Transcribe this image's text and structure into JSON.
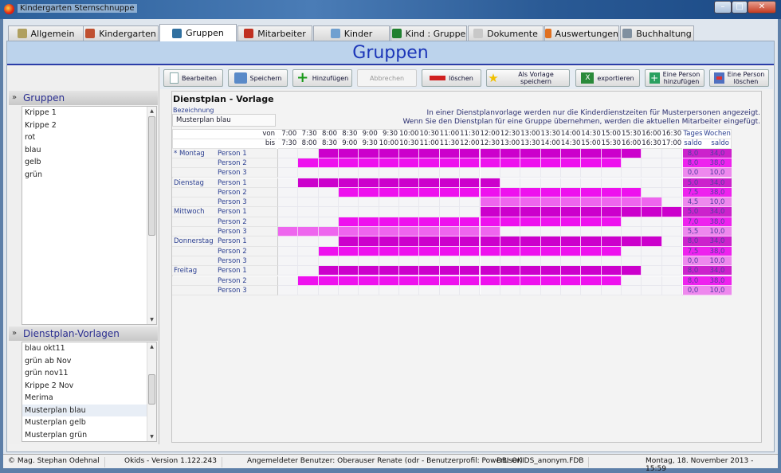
{
  "window": {
    "title": "Kindergarten Sternschnuppe",
    "controls": [
      "minimize",
      "maximize",
      "close"
    ]
  },
  "tabs": [
    {
      "label": "Allgemein",
      "icon": "tools-icon",
      "active": false
    },
    {
      "label": "Kindergarten",
      "icon": "house-icon",
      "active": false
    },
    {
      "label": "Gruppen",
      "icon": "group-icon",
      "active": true
    },
    {
      "label": "Mitarbeiter",
      "icon": "person-icon",
      "active": false
    },
    {
      "label": "Kinder",
      "icon": "children-icon",
      "active": false
    },
    {
      "label": "Kind : Gruppe",
      "icon": "tree-icon",
      "active": false
    },
    {
      "label": "Dokumente",
      "icon": "document-icon",
      "active": false
    },
    {
      "label": "Auswertungen",
      "icon": "chart-icon",
      "active": false
    },
    {
      "label": "Buchhaltung",
      "icon": "coins-icon",
      "active": false
    }
  ],
  "header": {
    "title": "Gruppen"
  },
  "toolbar": {
    "bearbeiten": "Bearbeiten",
    "speichern": "Speichern",
    "hinzufuegen": "Hinzufügen",
    "abbrechen": "Abbrechen",
    "loeschen": "löschen",
    "als_vorlage": "Als Vorlage speichern",
    "exportieren": "exportieren",
    "person_hinzu_1": "Eine Person",
    "person_hinzu_2": "hinzufügen",
    "person_loeschen_1": "Eine Person",
    "person_loeschen_2": "löschen"
  },
  "sidebar": {
    "gruppen_title": "Gruppen",
    "gruppen": [
      "Krippe 1",
      "Krippe 2",
      "rot",
      "blau",
      "gelb",
      "grün"
    ],
    "vorlagen_title": "Dienstplan-Vorlagen",
    "vorlagen": [
      "blau okt11",
      "grün ab Nov",
      "grün nov11",
      "Krippe 2 Nov",
      "Merima",
      "Musterplan blau",
      "Musterplan gelb",
      "Musterplan grün"
    ],
    "vorlagen_selected": "Musterplan blau"
  },
  "main": {
    "title": "Dienstplan - Vorlage",
    "bezeichnung_label": "Bezeichnung",
    "bezeichnung_value": "Musterplan blau",
    "info_line1": "In einer Dienstplanvorlage werden nur die Kinderdienstzeiten für Musterpersonen angezeigt.",
    "info_line2": "Wenn Sie den Dienstplan für eine Gruppe übernehmen, werden die aktuellen Mitarbeiter eingefügt."
  },
  "grid": {
    "von_label": "von",
    "bis_label": "bis",
    "von": [
      "7:00",
      "7:30",
      "8:00",
      "8:30",
      "9:00",
      "9:30",
      "10:00",
      "10:30",
      "11:00",
      "11:30",
      "12:00",
      "12:30",
      "13:00",
      "13:30",
      "14:00",
      "14:30",
      "15:00",
      "15:30",
      "16:00",
      "16:30"
    ],
    "bis": [
      "7:30",
      "8:00",
      "8:30",
      "9:00",
      "9:30",
      "10:00",
      "10:30",
      "11:00",
      "11:30",
      "12:00",
      "12:30",
      "13:00",
      "13:30",
      "14:00",
      "14:30",
      "15:00",
      "15:30",
      "16:00",
      "16:30",
      "17:00"
    ],
    "tages_1": "Tages",
    "tages_2": "saldo",
    "wochen_1": "Wochen",
    "wochen_2": "saldo",
    "person_colors": {
      "Person 1": "#cc00cc",
      "Person 2": "#ee11ee",
      "Person 3": "#ee66ee"
    },
    "saldo_colors": {
      "Person 1": "#cc22cc",
      "Person 2": "#ee22ee",
      "Person 3": "#ee88ee"
    },
    "rows": [
      {
        "day": "* Montag",
        "person": "Person 1",
        "start": "8:00",
        "end": "16:00",
        "tages": "8,0",
        "wochen": "34,0"
      },
      {
        "day": "",
        "person": "Person 2",
        "start": "7:30",
        "end": "15:30",
        "tages": "8,0",
        "wochen": "38,0"
      },
      {
        "day": "",
        "person": "Person 3",
        "start": null,
        "end": null,
        "tages": "0,0",
        "wochen": "10,0"
      },
      {
        "day": "Dienstag",
        "person": "Person 1",
        "start": "7:30",
        "end": "12:30",
        "tages": "5,0",
        "wochen": "34,0"
      },
      {
        "day": "",
        "person": "Person 2",
        "start": "8:30",
        "end": "16:00",
        "tages": "7,5",
        "wochen": "38,0"
      },
      {
        "day": "",
        "person": "Person 3",
        "start": "12:00",
        "end": "16:30",
        "tages": "4,5",
        "wochen": "10,0"
      },
      {
        "day": "Mittwoch",
        "person": "Person 1",
        "start": "12:00",
        "end": "17:00",
        "tages": "5,0",
        "wochen": "34,0"
      },
      {
        "day": "",
        "person": "Person 2",
        "start": "8:30",
        "end": "15:30",
        "tages": "7,0",
        "wochen": "38,0"
      },
      {
        "day": "",
        "person": "Person 3",
        "start": "7:00",
        "end": "12:30",
        "tages": "5,5",
        "wochen": "10,0"
      },
      {
        "day": "Donnerstag",
        "person": "Person 1",
        "start": "8:30",
        "end": "16:30",
        "tages": "8,0",
        "wochen": "34,0"
      },
      {
        "day": "",
        "person": "Person 2",
        "start": "8:00",
        "end": "15:30",
        "tages": "7,5",
        "wochen": "38,0"
      },
      {
        "day": "",
        "person": "Person 3",
        "start": null,
        "end": null,
        "tages": "0,0",
        "wochen": "10,0"
      },
      {
        "day": "Freitag",
        "person": "Person 1",
        "start": "8:00",
        "end": "16:00",
        "tages": "8,0",
        "wochen": "34,0"
      },
      {
        "day": "",
        "person": "Person 2",
        "start": "7:30",
        "end": "15:30",
        "tages": "8,0",
        "wochen": "38,0"
      },
      {
        "day": "",
        "person": "Person 3",
        "start": null,
        "end": null,
        "tages": "0,0",
        "wochen": "10,0"
      }
    ]
  },
  "status": {
    "copyright": "© Mag. Stephan Odehnal",
    "version": "Okids - Version 1.122.243",
    "user": "Angemeldeter Benutzer: Oberauser Renate (odr - Benutzerprofil: PowerUser)",
    "db": "DB: OKIDS_anonym.FDB",
    "datetime": "Montag, 18. November 2013 - 15:59"
  }
}
